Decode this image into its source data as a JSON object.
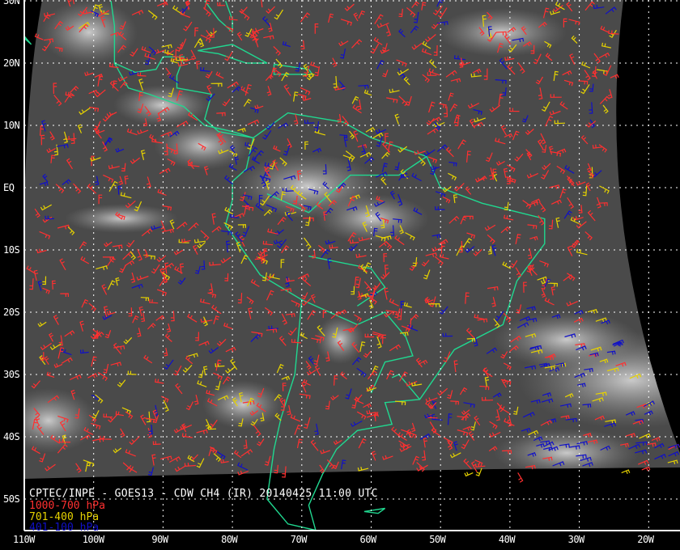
{
  "title": "CPTEC/INPE - GOES13 - CDW CH4 (IR) 20140425 11:00 UTC",
  "legend": [
    {
      "label": "1000-700 hPa",
      "color": "#ff3030"
    },
    {
      "label": "701-400 hPa",
      "color": "#e6d200"
    },
    {
      "label": "401-100 hPa",
      "color": "#1010c8"
    }
  ],
  "lat_labels": [
    "30N",
    "20N",
    "10N",
    "EQ",
    "10S",
    "20S",
    "30S",
    "40S",
    "50S"
  ],
  "lon_labels": [
    "110W",
    "100W",
    "90W",
    "80W",
    "70W",
    "60W",
    "50W",
    "40W",
    "30W",
    "20W"
  ],
  "coastline_color": "#20d890"
}
